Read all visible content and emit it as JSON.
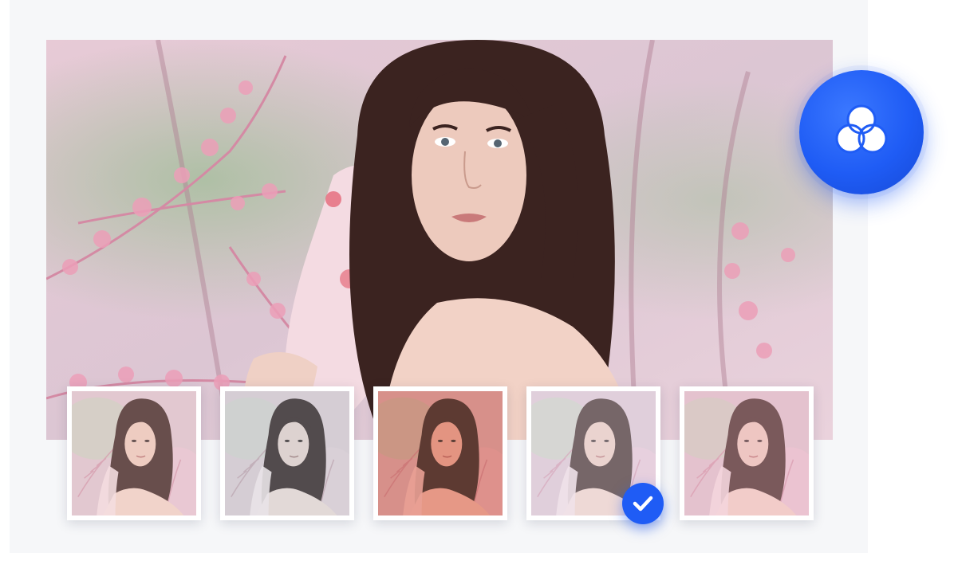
{
  "app": {
    "panel_background": "#f6f7f9",
    "accent_color": "#1f5cf5"
  },
  "hero_photo": {
    "subject": "portrait-photo",
    "palette": {
      "blossom": "#e8b7c8",
      "foliage": "#9bb08f",
      "hair": "#3a2220",
      "skin": "#ecc9bd"
    }
  },
  "filter_button": {
    "icon": "color-filter-icon",
    "color": "#1f5cf5"
  },
  "filter_thumbnails": [
    {
      "id": "original",
      "tint": "#f3d5cf",
      "tint_opacity": 0.25,
      "selected": false
    },
    {
      "id": "mono-cool",
      "tint": "#dfe3e6",
      "tint_opacity": 0.55,
      "selected": false
    },
    {
      "id": "red-warm",
      "tint": "#e0452b",
      "tint_opacity": 0.45,
      "selected": false
    },
    {
      "id": "soft-pastel",
      "tint": "#e9e4f0",
      "tint_opacity": 0.35,
      "selected": true
    },
    {
      "id": "pink-fade",
      "tint": "#f4c0cc",
      "tint_opacity": 0.35,
      "selected": false
    }
  ],
  "selected_badge": {
    "icon": "checkmark-icon",
    "color": "#1f5cf5"
  }
}
